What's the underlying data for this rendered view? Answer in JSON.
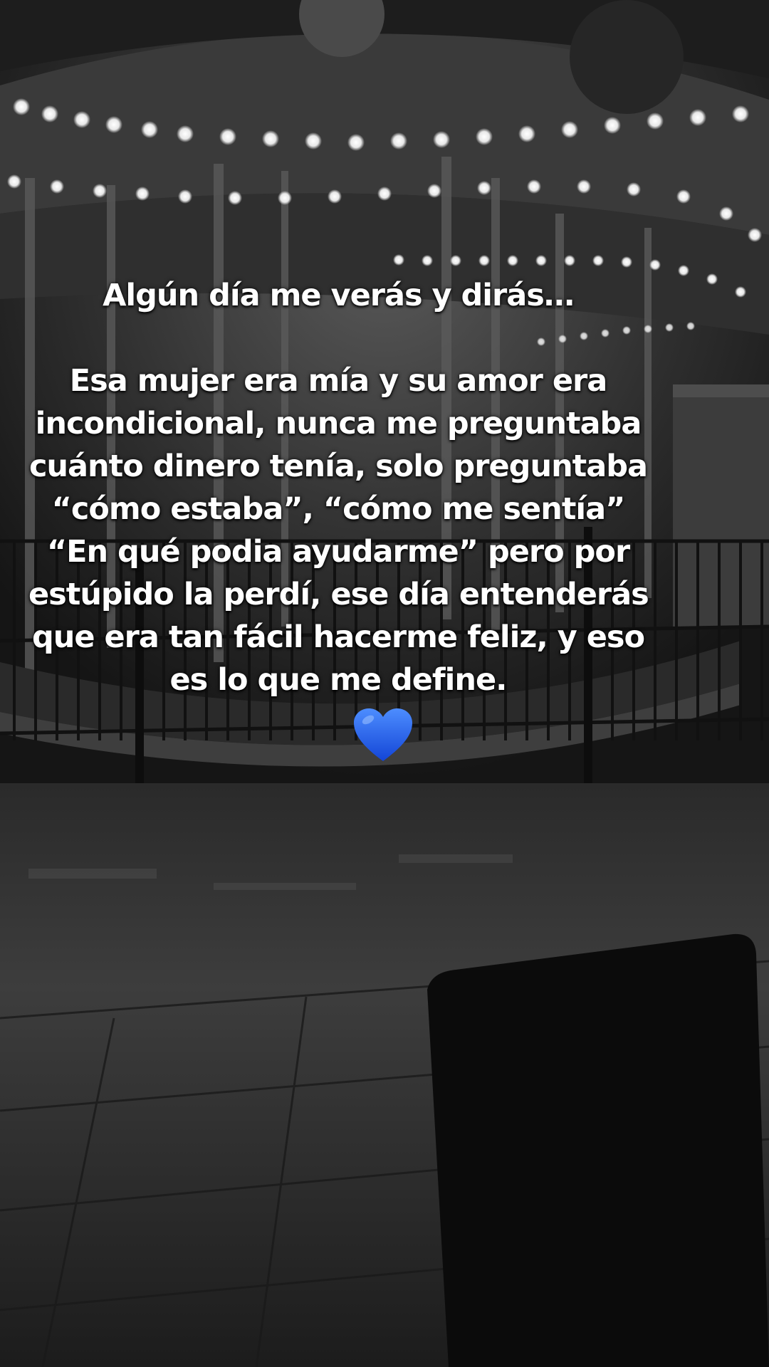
{
  "caption": {
    "intro": "Algún día me verás y dirás…",
    "lines": [
      "Esa mujer era mía y su amor era",
      "incondicional, nunca me preguntaba",
      "cuánto dinero tenía, solo preguntaba",
      "“cómo estaba”, “cómo me sentía”",
      "“En qué podia ayudarme” pero por",
      "estúpido la perdí, ese día entenderás",
      "que era tan fácil hacerme feliz, y eso",
      "es lo que me define."
    ]
  },
  "emoji": {
    "name": "blue-heart-icon",
    "color": "#1f5fe8"
  },
  "photo": {
    "subject": "carousel-background",
    "palette": "grayscale"
  }
}
